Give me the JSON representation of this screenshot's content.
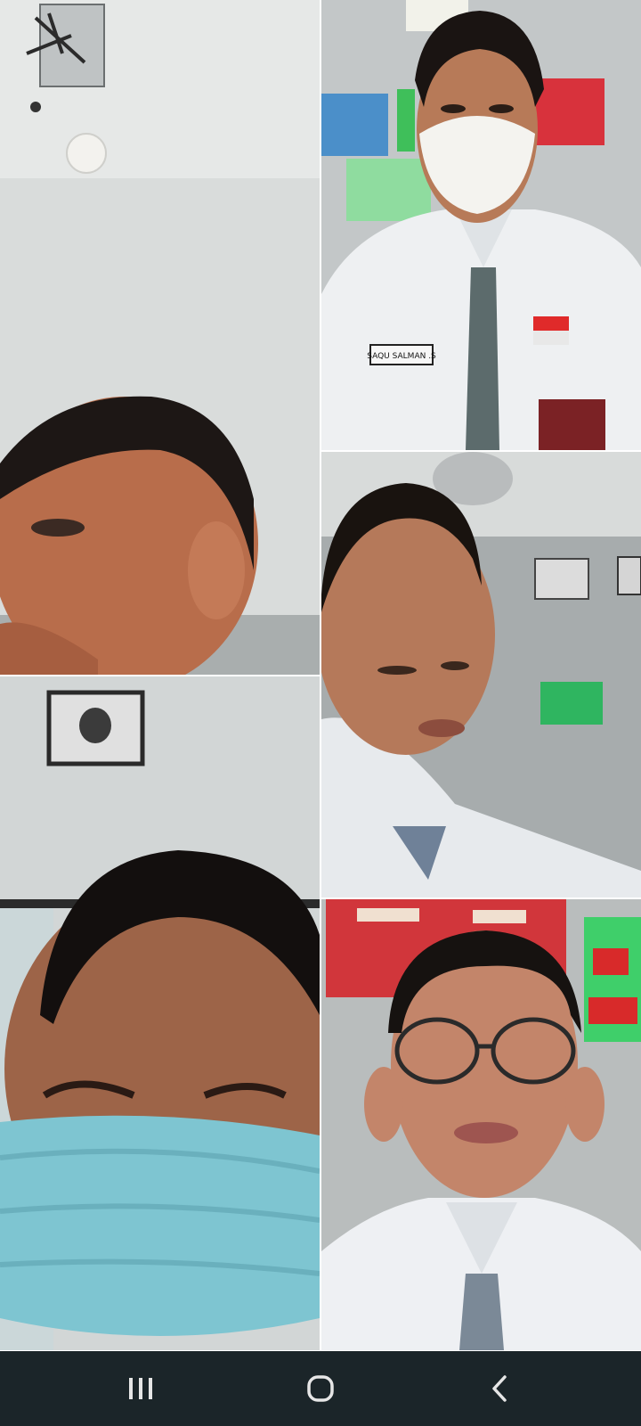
{
  "tiles": [
    {
      "id": "participant-1",
      "name_tag": ""
    },
    {
      "id": "participant-2",
      "name_tag": "SAQU SALMAN .S"
    },
    {
      "id": "participant-3",
      "name_tag": ""
    },
    {
      "id": "participant-4",
      "name_tag": ""
    },
    {
      "id": "participant-5",
      "name_tag": ""
    }
  ],
  "navbar": {
    "buttons": [
      {
        "icon": "recent-apps-icon"
      },
      {
        "icon": "home-icon"
      },
      {
        "icon": "back-icon"
      }
    ],
    "background": "#1b2529",
    "icon_color": "#e6e6e6"
  }
}
